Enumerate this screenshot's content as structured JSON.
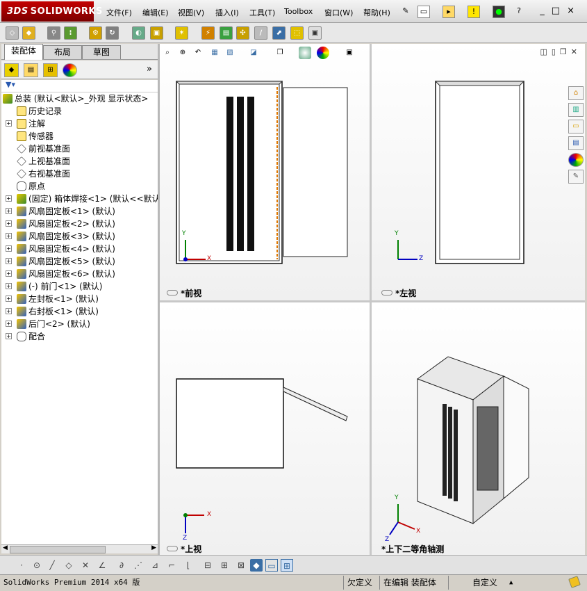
{
  "app": {
    "brand": "SOLIDWORKS",
    "brand_prefix": "3DS"
  },
  "menu": [
    "文件(F)",
    "编辑(E)",
    "视图(V)",
    "插入(I)",
    "工具(T)",
    "Toolbox",
    "窗口(W)",
    "帮助(H)"
  ],
  "window_controls": {
    "minimize": "_",
    "restore": "□",
    "close": "×"
  },
  "manager_tabs": [
    {
      "label": "装配体",
      "active": true
    },
    {
      "label": "布局",
      "active": false
    },
    {
      "label": "草图",
      "active": false
    }
  ],
  "manager_expand": "»",
  "tree": {
    "root": "总装  (默认<默认>_外观 显示状态>",
    "items": [
      {
        "label": "历史记录",
        "icon": "history-icon",
        "expandable": false
      },
      {
        "label": "注解",
        "icon": "annotation-icon",
        "expandable": true
      },
      {
        "label": "传感器",
        "icon": "sensor-icon",
        "expandable": false
      },
      {
        "label": "前视基准面",
        "icon": "plane-icon",
        "expandable": false
      },
      {
        "label": "上视基准面",
        "icon": "plane-icon",
        "expandable": false
      },
      {
        "label": "右视基准面",
        "icon": "plane-icon",
        "expandable": false
      },
      {
        "label": "原点",
        "icon": "origin-icon",
        "expandable": false
      },
      {
        "label": "(固定) 箱体焊接<1> (默认<<默认",
        "icon": "assembly-icon",
        "expandable": true
      },
      {
        "label": "风扇固定板<1> (默认)",
        "icon": "part-icon",
        "expandable": true
      },
      {
        "label": "风扇固定板<2> (默认)",
        "icon": "part-icon",
        "expandable": true
      },
      {
        "label": "风扇固定板<3> (默认)",
        "icon": "part-icon",
        "expandable": true
      },
      {
        "label": "风扇固定板<4> (默认)",
        "icon": "part-icon",
        "expandable": true
      },
      {
        "label": "风扇固定板<5> (默认)",
        "icon": "part-icon",
        "expandable": true
      },
      {
        "label": "风扇固定板<6> (默认)",
        "icon": "part-icon",
        "expandable": true
      },
      {
        "label": "(-) 前门<1> (默认)",
        "icon": "part-icon",
        "expandable": true
      },
      {
        "label": "左封板<1> (默认)",
        "icon": "part-icon",
        "expandable": true
      },
      {
        "label": "右封板<1> (默认)",
        "icon": "part-icon",
        "expandable": true
      },
      {
        "label": "后门<2> (默认)",
        "icon": "part-icon",
        "expandable": true
      },
      {
        "label": "配合",
        "icon": "mates-icon",
        "expandable": true
      }
    ]
  },
  "viewports": [
    {
      "id": "front",
      "label": "*前视",
      "axes": [
        "Y",
        "X"
      ]
    },
    {
      "id": "left",
      "label": "*左视",
      "axes": [
        "Y",
        "Z"
      ]
    },
    {
      "id": "top",
      "label": "*上视",
      "axes": [
        "X",
        "Z"
      ]
    },
    {
      "id": "iso",
      "label": "*上下二等角轴测",
      "axes": [
        "Y",
        "X",
        "Z"
      ]
    }
  ],
  "status": {
    "product": "SolidWorks Premium 2014 x64 版",
    "underdefined": "欠定义",
    "editing": "在编辑 装配体",
    "units": "自定义"
  },
  "colors": {
    "brand_red": "#a00000",
    "accent_blue": "#3a6ea5",
    "axis_red": "#c00000",
    "axis_green": "#008000",
    "axis_blue": "#0000c0"
  }
}
